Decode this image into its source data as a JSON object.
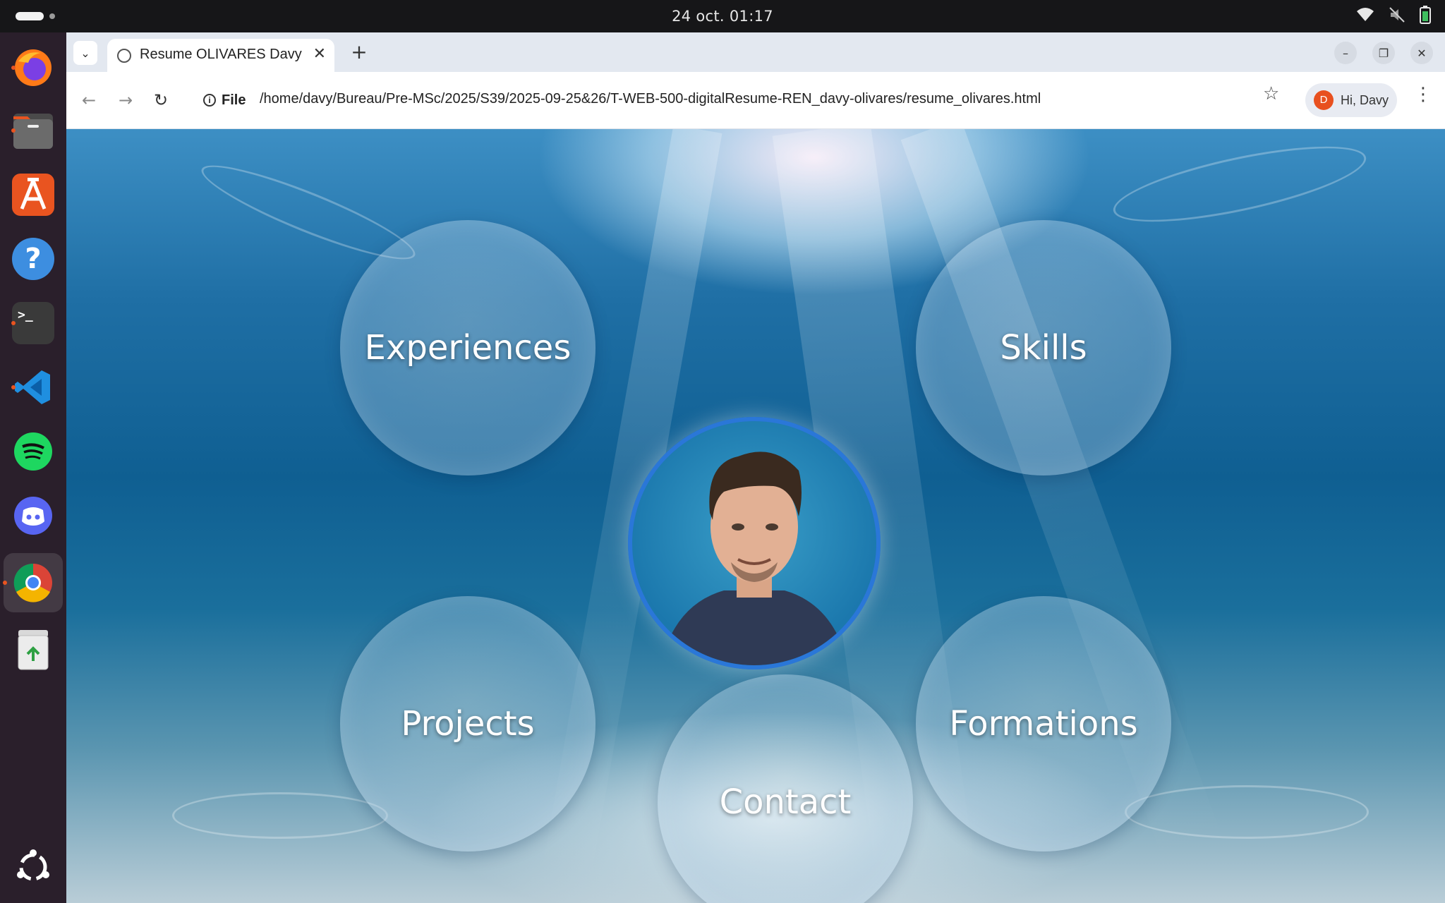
{
  "system": {
    "datetime": "24 oct.  01:17"
  },
  "dock": {
    "items": [
      {
        "name": "Firefox",
        "icon": "firefox-icon",
        "running": true
      },
      {
        "name": "Files",
        "icon": "files-icon",
        "running": true
      },
      {
        "name": "App Center",
        "icon": "app-center-icon",
        "running": false
      },
      {
        "name": "Help",
        "icon": "help-icon",
        "running": false
      },
      {
        "name": "Terminal",
        "icon": "terminal-icon",
        "running": true
      },
      {
        "name": "Visual Studio Code",
        "icon": "vscode-icon",
        "running": true
      },
      {
        "name": "Spotify",
        "icon": "spotify-icon",
        "running": false
      },
      {
        "name": "Discord",
        "icon": "discord-icon",
        "running": false
      },
      {
        "name": "Google Chrome",
        "icon": "chrome-icon",
        "running": true
      },
      {
        "name": "Trash",
        "icon": "trash-icon",
        "running": false
      }
    ]
  },
  "browser": {
    "tab_title": "Resume OLIVARES Davy",
    "scheme_label": "File",
    "url": "/home/davy/Bureau/Pre-MSc/2025/S39/2025-09-25&26/T-WEB-500-digitalResume-REN_davy-olivares/resume_olivares.html",
    "profile_initial": "D",
    "profile_label": "Hi, Davy"
  },
  "page": {
    "nav": {
      "experiences": "Experiences",
      "skills": "Skills",
      "projects": "Projects",
      "formations": "Formations",
      "contact": "Contact"
    }
  },
  "colors": {
    "accent_ring": "#2a77d8",
    "ubuntu_orange": "#e95420",
    "tabstrip": "#e3e8f0"
  }
}
